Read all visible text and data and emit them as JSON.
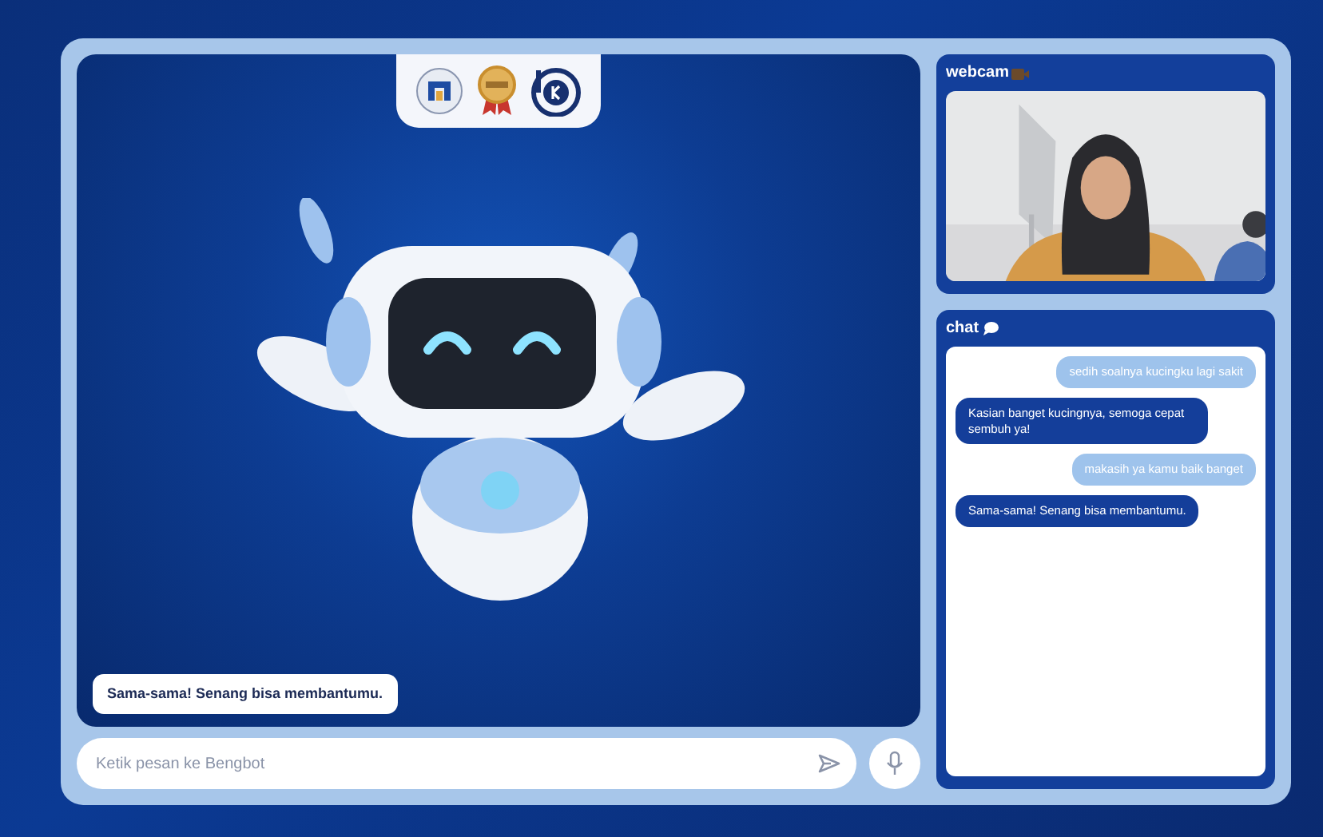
{
  "stage": {
    "subtitle": "Sama-sama! Senang bisa membantumu."
  },
  "input": {
    "placeholder": "Ketik pesan ke Bengbot"
  },
  "webcam": {
    "title": "webcam"
  },
  "chat": {
    "title": "chat",
    "messages": [
      {
        "kind": "user",
        "text": "sedih soalnya kucingku lagi sakit"
      },
      {
        "kind": "bot",
        "text": "Kasian banget kucingnya, semoga cepat sembuh ya!"
      },
      {
        "kind": "user",
        "text": "makasih ya kamu baik banget"
      },
      {
        "kind": "bot",
        "text": "Sama-sama! Senang bisa membantumu."
      }
    ]
  }
}
